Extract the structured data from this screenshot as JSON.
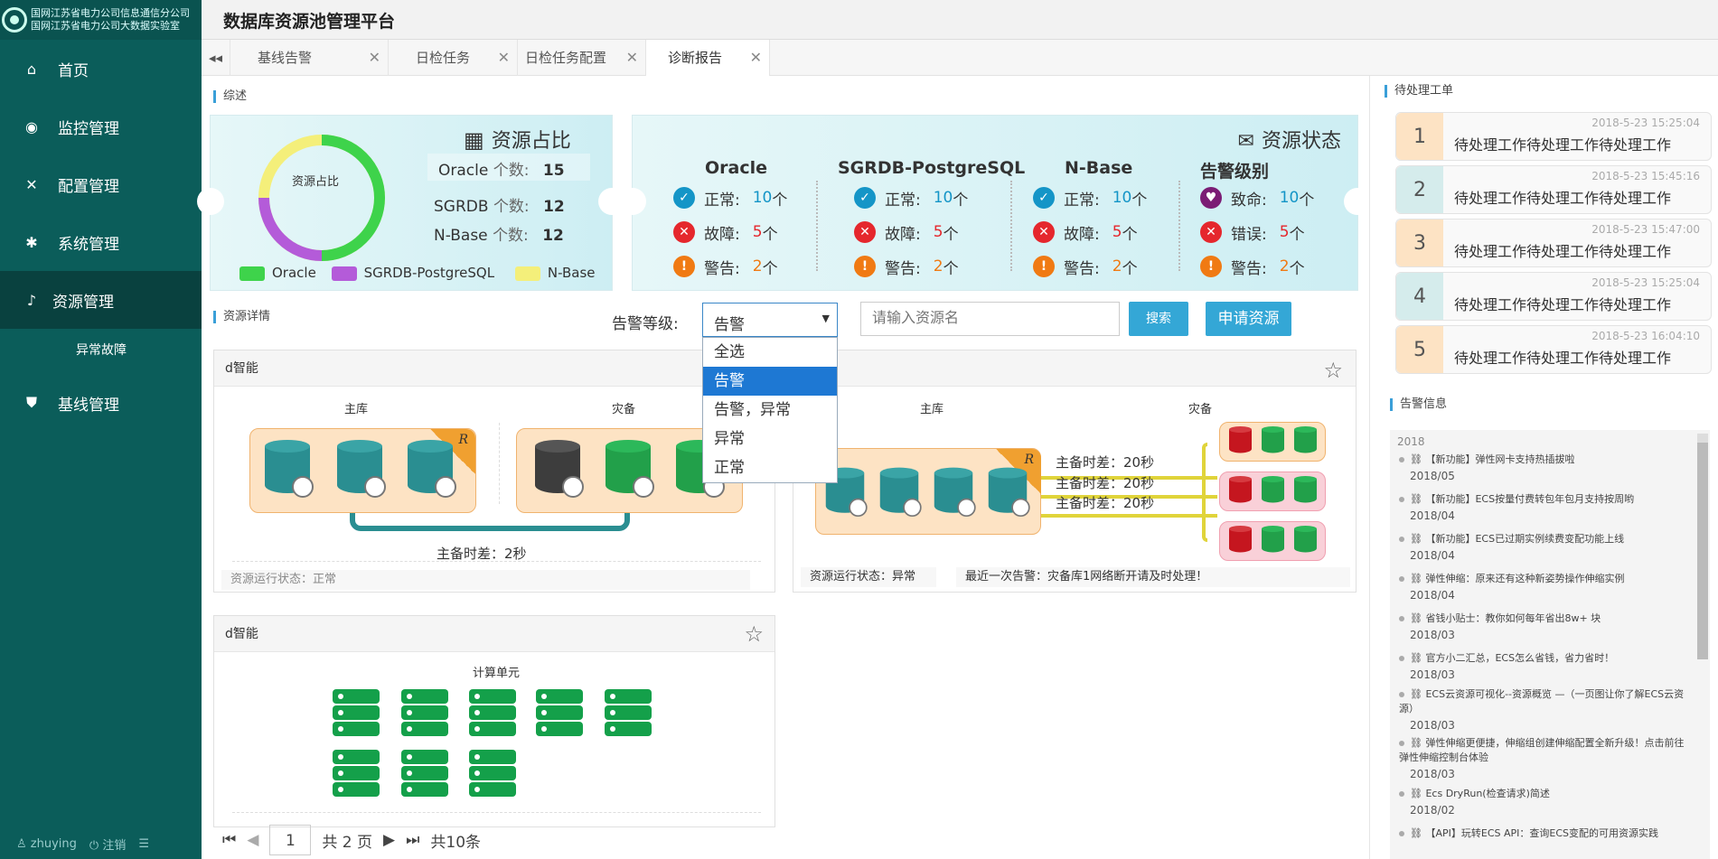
{
  "sidebar": {
    "logo_line1": "国网江苏省电力公司信息通信分公司",
    "logo_line2": "国网江苏省电力公司大数据实验室",
    "items": [
      {
        "label": "首页",
        "icon": "home-icon"
      },
      {
        "label": "监控管理",
        "icon": "monitor-icon"
      },
      {
        "label": "配置管理",
        "icon": "tools-icon"
      },
      {
        "label": "系统管理",
        "icon": "gear-icon"
      },
      {
        "label": "资源管理",
        "icon": "bell-icon"
      },
      {
        "label": "异常故障",
        "icon": ""
      },
      {
        "label": "基线管理",
        "icon": "shield-icon"
      }
    ],
    "user": "zhuying",
    "logout": "注销"
  },
  "header": {
    "title": "数据库资源池管理平台"
  },
  "tabs": [
    {
      "label": "基线告警"
    },
    {
      "label": "日检任务"
    },
    {
      "label": "日检任务配置"
    },
    {
      "label": "诊断报告"
    }
  ],
  "overview": {
    "section": "综述",
    "ratio_title": "资源占比",
    "donut_label": "资源占比",
    "counts": [
      {
        "name": "Oracle",
        "suffix": "个数:",
        "value": "15"
      },
      {
        "name": "SGRDB",
        "suffix": "个数:",
        "value": "12"
      },
      {
        "name": "N-Base",
        "suffix": "个数:",
        "value": "12"
      }
    ],
    "legend": [
      {
        "name": "Oracle",
        "color": "#3ed34b"
      },
      {
        "name": "SGRDB-PostgreSQL",
        "color": "#b45bd9"
      },
      {
        "name": "N-Base",
        "color": "#f4ef7a"
      }
    ],
    "donut_share": {
      "Oracle": 0.5,
      "SGRDB-PostgreSQL": 0.25,
      "N-Base": 0.25
    },
    "status_title": "资源状态",
    "columns": [
      {
        "title": "Oracle",
        "rows": [
          {
            "label": "正常:",
            "value": "10",
            "unit": "个"
          },
          {
            "label": "故障:",
            "value": "5",
            "unit": "个"
          },
          {
            "label": "警告:",
            "value": "2",
            "unit": "个"
          }
        ]
      },
      {
        "title": "SGRDB-PostgreSQL",
        "rows": [
          {
            "label": "正常:",
            "value": "10",
            "unit": "个"
          },
          {
            "label": "故障:",
            "value": "5",
            "unit": "个"
          },
          {
            "label": "警告:",
            "value": "2",
            "unit": "个"
          }
        ]
      },
      {
        "title": "N-Base",
        "rows": [
          {
            "label": "正常:",
            "value": "10",
            "unit": "个"
          },
          {
            "label": "故障:",
            "value": "5",
            "unit": "个"
          },
          {
            "label": "警告:",
            "value": "2",
            "unit": "个"
          }
        ]
      },
      {
        "title": "告警级别",
        "rows": [
          {
            "label": "致命:",
            "value": "10",
            "unit": "个"
          },
          {
            "label": "错误:",
            "value": "5",
            "unit": "个"
          },
          {
            "label": "警告:",
            "value": "2",
            "unit": "个"
          }
        ]
      }
    ]
  },
  "detail": {
    "section": "资源详情",
    "alert_level_label": "告警等级:",
    "alert_level_value": "告警",
    "options": [
      "全选",
      "告警",
      "告警，异常",
      "异常",
      "正常"
    ],
    "search_placeholder": "请输入资源名",
    "search_btn": "搜索",
    "apply_btn": "申请资源"
  },
  "panels": {
    "p1": {
      "title": "d智能",
      "primary": "主库",
      "backup": "灾备",
      "lag": "主备时差：2秒",
      "status": "资源运行状态：正常"
    },
    "p2": {
      "primary": "主库",
      "backup": "灾备",
      "lags": [
        "主备时差：20秒",
        "主备时差：20秒",
        "主备时差：20秒"
      ],
      "status": "资源运行状态：异常",
      "last_alert": "最近一次告警：灾备库1网络断开请及时处理！"
    },
    "p3": {
      "title": "d智能",
      "unit_label": "计算单元"
    }
  },
  "pager": {
    "page": "1",
    "total_pages": "共 2 页",
    "total": "共10条"
  },
  "tickets": {
    "section": "待处理工单",
    "items": [
      {
        "n": "1",
        "time": "2018-5-23 15:25:04",
        "text": "待处理工作待处理工作待处理工作"
      },
      {
        "n": "2",
        "time": "2018-5-23 15:45:16",
        "text": "待处理工作待处理工作待处理工作"
      },
      {
        "n": "3",
        "time": "2018-5-23 15:47:00",
        "text": "待处理工作待处理工作待处理工作"
      },
      {
        "n": "4",
        "time": "2018-5-23 15:25:04",
        "text": "待处理工作待处理工作待处理工作"
      },
      {
        "n": "5",
        "time": "2018-5-23 16:04:10",
        "text": "待处理工作待处理工作待处理工作"
      }
    ]
  },
  "alerts": {
    "section": "告警信息",
    "year": "2018",
    "items": [
      {
        "text": "【新功能】弹性网卡支持热插拔啦",
        "date": "2018/05"
      },
      {
        "text": "【新功能】ECS按量付费转包年包月支持按周哟",
        "date": "2018/04"
      },
      {
        "text": "【新功能】ECS已过期实例续费变配功能上线",
        "date": "2018/04"
      },
      {
        "text": "弹性伸缩：原来还有这种新姿势操作伸缩实例",
        "date": "2018/04"
      },
      {
        "text": "省钱小贴士：教你如何每年省出8w+ 块",
        "date": "2018/03"
      },
      {
        "text": "官方小二汇总，ECS怎么省钱，省力省时！",
        "date": "2018/03"
      },
      {
        "text": "ECS云资源可视化--资源概览 —（一页图让你了解ECS云资源）",
        "date": "2018/03"
      },
      {
        "text": "弹性伸缩更便捷，伸缩组创建伸缩配置全新升级！点击前往弹性伸缩控制台体验",
        "date": "2018/03"
      },
      {
        "text": "Ecs DryRun(检查请求)简述",
        "date": "2018/02"
      },
      {
        "text": "【API】玩转ECS API：查询ECS变配的可用资源实践",
        "date": ""
      }
    ]
  }
}
